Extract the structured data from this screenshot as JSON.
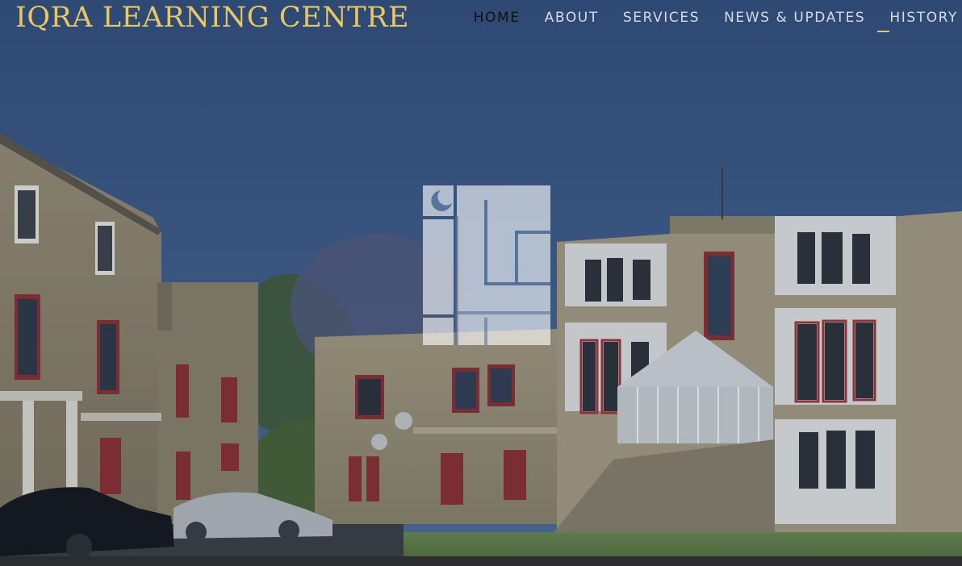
{
  "brand": {
    "title": "IQRA LEARNING CENTRE",
    "color": "#e7c766"
  },
  "nav": {
    "items": [
      {
        "label": "HOME",
        "active": true
      },
      {
        "label": "ABOUT",
        "active": false
      },
      {
        "label": "SERVICES",
        "active": false
      },
      {
        "label": "NEWS & UPDATES",
        "active": false
      },
      {
        "label": "HISTORY",
        "active": false,
        "underline": true
      }
    ],
    "active_color": "#111111",
    "color": "#d7dbe3",
    "underline_color": "#e7c766"
  },
  "hero": {
    "image": "building-photo",
    "logo": "ilc-logo-icon"
  }
}
